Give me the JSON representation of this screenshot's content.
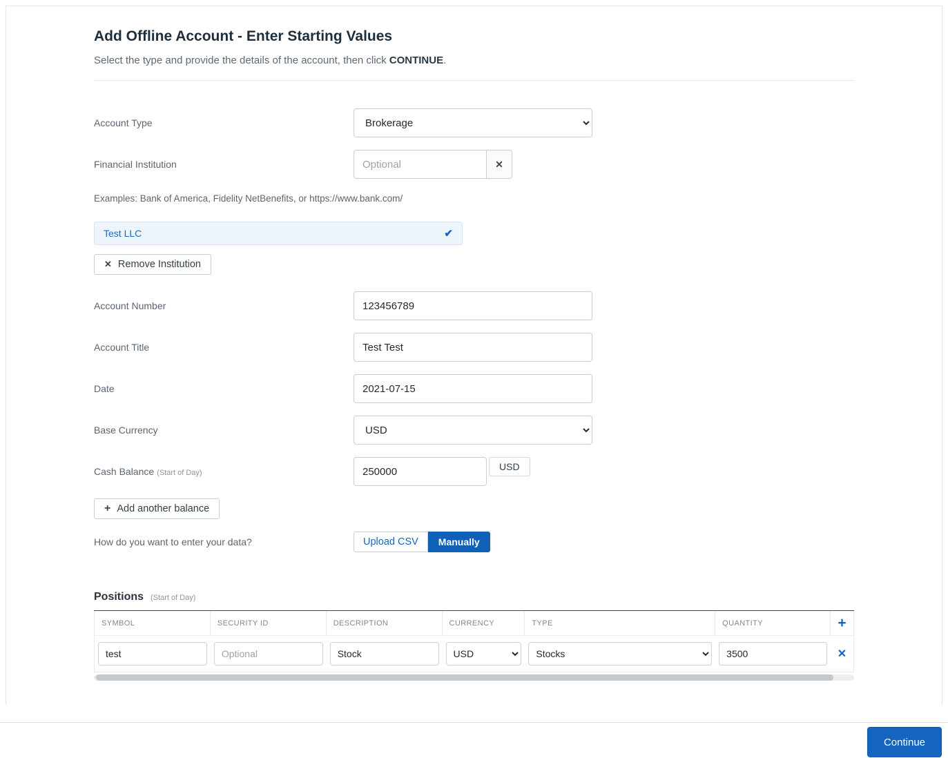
{
  "header": {
    "title": "Add Offline Account - Enter Starting Values",
    "subtitle_prefix": "Select the type and provide the details of the account, then click ",
    "subtitle_bold": "CONTINUE",
    "subtitle_suffix": "."
  },
  "form": {
    "account_type": {
      "label": "Account Type",
      "selected": "Brokerage"
    },
    "financial_institution": {
      "label": "Financial Institution",
      "placeholder": "Optional"
    },
    "examples": "Examples: Bank of America, Fidelity NetBenefits, or https://www.bank.com/",
    "selected_institution": "Test LLC",
    "remove_institution": "Remove Institution",
    "account_number": {
      "label": "Account Number",
      "value": "123456789"
    },
    "account_title": {
      "label": "Account Title",
      "value": "Test Test"
    },
    "date": {
      "label": "Date",
      "value": "2021-07-15"
    },
    "base_currency": {
      "label": "Base Currency",
      "selected": "USD"
    },
    "cash_balance": {
      "label": "Cash Balance",
      "sublabel": "(Start of Day)",
      "value": "250000",
      "currency": "USD"
    },
    "add_another_balance": "Add another balance",
    "data_entry": {
      "label": "How do you want to enter your data?",
      "upload_csv": "Upload CSV",
      "manually": "Manually"
    }
  },
  "positions": {
    "title": "Positions",
    "sublabel": "(Start of Day)",
    "columns": {
      "symbol": "SYMBOL",
      "security_id": "SECURITY ID",
      "description": "DESCRIPTION",
      "currency": "CURRENCY",
      "type": "TYPE",
      "quantity": "QUANTITY"
    },
    "rows": [
      {
        "symbol": "test",
        "security_id_placeholder": "Optional",
        "description": "Stock",
        "currency": "USD",
        "type": "Stocks",
        "quantity": "3500"
      }
    ]
  },
  "footer": {
    "continue": "Continue"
  },
  "icons": {
    "clear": "✕",
    "check": "✔",
    "plus": "+",
    "add": "+",
    "delete": "✕"
  },
  "colors": {
    "accent_blue": "#1565c0",
    "selected_row_bg": "#eef4fc"
  }
}
